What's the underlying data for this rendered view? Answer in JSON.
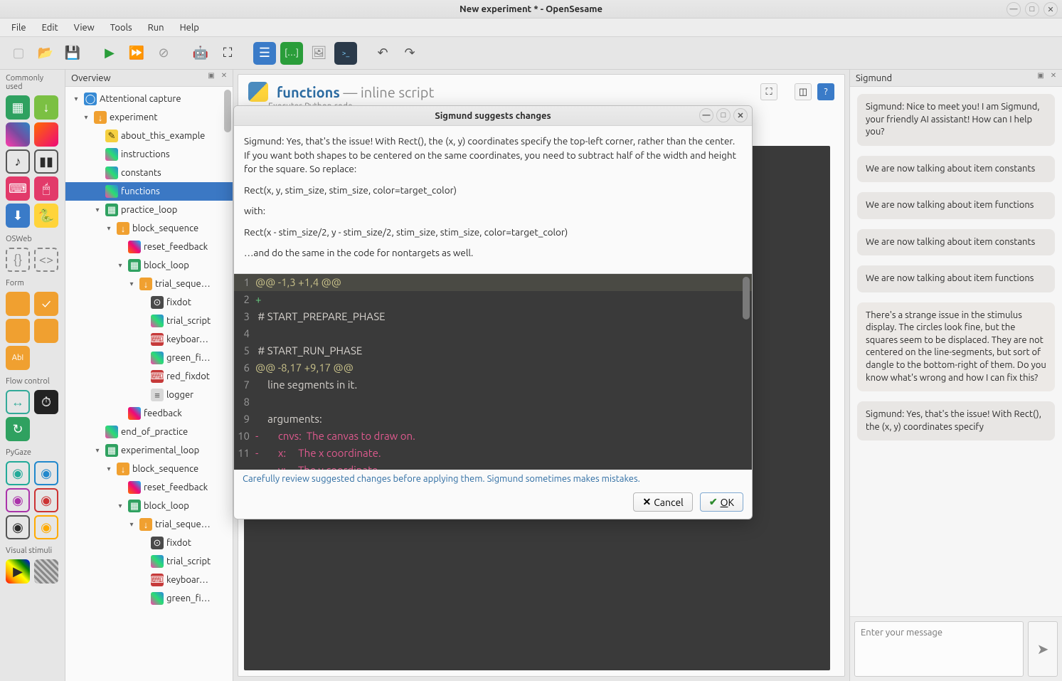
{
  "window": {
    "title": "New experiment * - OpenSesame"
  },
  "menus": [
    "File",
    "Edit",
    "View",
    "Tools",
    "Run",
    "Help"
  ],
  "palette": [
    {
      "label": "Commonly used"
    },
    {
      "label": "OSWeb"
    },
    {
      "label": "Form"
    },
    {
      "label": "Flow control"
    },
    {
      "label": "PyGaze"
    },
    {
      "label": "Visual stimuli"
    }
  ],
  "overview": {
    "title": "Overview",
    "items": [
      {
        "lvl": 0,
        "arrow": "▾",
        "icon": "exp",
        "label": "Attentional capture"
      },
      {
        "lvl": 1,
        "arrow": "▾",
        "icon": "seq",
        "label": "experiment"
      },
      {
        "lvl": 2,
        "arrow": "",
        "icon": "note",
        "label": "about_this_example"
      },
      {
        "lvl": 2,
        "arrow": "",
        "icon": "inline",
        "label": "instructions"
      },
      {
        "lvl": 2,
        "arrow": "",
        "icon": "inline",
        "label": "constants"
      },
      {
        "lvl": 2,
        "arrow": "",
        "icon": "inline",
        "label": "functions",
        "selected": true
      },
      {
        "lvl": 2,
        "arrow": "▾",
        "icon": "loop",
        "label": "practice_loop"
      },
      {
        "lvl": 3,
        "arrow": "▾",
        "icon": "seq",
        "label": "block_sequence"
      },
      {
        "lvl": 4,
        "arrow": "",
        "icon": "fb",
        "label": "reset_feedback"
      },
      {
        "lvl": 4,
        "arrow": "▾",
        "icon": "loop",
        "label": "block_loop"
      },
      {
        "lvl": 5,
        "arrow": "▾",
        "icon": "seq",
        "label": "trial_seque…"
      },
      {
        "lvl": 6,
        "arrow": "",
        "icon": "fix",
        "label": "fixdot"
      },
      {
        "lvl": 6,
        "arrow": "",
        "icon": "inline",
        "label": "trial_script"
      },
      {
        "lvl": 6,
        "arrow": "",
        "icon": "kb",
        "label": "keyboar…"
      },
      {
        "lvl": 6,
        "arrow": "",
        "icon": "inline",
        "label": "green_fi…"
      },
      {
        "lvl": 6,
        "arrow": "",
        "icon": "kb",
        "label": "red_fixdot"
      },
      {
        "lvl": 6,
        "arrow": "",
        "icon": "log",
        "label": "logger"
      },
      {
        "lvl": 4,
        "arrow": "",
        "icon": "fb",
        "label": "feedback"
      },
      {
        "lvl": 2,
        "arrow": "",
        "icon": "inline",
        "label": "end_of_practice"
      },
      {
        "lvl": 2,
        "arrow": "▾",
        "icon": "loop",
        "label": "experimental_loop"
      },
      {
        "lvl": 3,
        "arrow": "▾",
        "icon": "seq",
        "label": "block_sequence"
      },
      {
        "lvl": 4,
        "arrow": "",
        "icon": "fb",
        "label": "reset_feedback"
      },
      {
        "lvl": 4,
        "arrow": "▾",
        "icon": "loop",
        "label": "block_loop"
      },
      {
        "lvl": 5,
        "arrow": "▾",
        "icon": "seq",
        "label": "trial_seque…"
      },
      {
        "lvl": 6,
        "arrow": "",
        "icon": "fix",
        "label": "fixdot"
      },
      {
        "lvl": 6,
        "arrow": "",
        "icon": "inline",
        "label": "trial_script"
      },
      {
        "lvl": 6,
        "arrow": "",
        "icon": "kb",
        "label": "keyboar…"
      },
      {
        "lvl": 6,
        "arrow": "",
        "icon": "inline",
        "label": "green_fi…"
      }
    ]
  },
  "editor": {
    "item_name": "functions",
    "item_type": " — inline script",
    "subtitle": "Executes Python code"
  },
  "dialog": {
    "title": "Sigmund suggests changes",
    "explain1": "Sigmund: Yes, that's the issue! With Rect(), the (x, y) coordinates specify the top-left corner, rather than the center. If you want both shapes to be centered on the same coordinates, you need to subtract half of the width and height for the square. So replace:",
    "code1": "Rect(x, y, stim_size, stim_size, color=target_color)",
    "with": "with:",
    "code2": "Rect(x - stim_size/2, y - stim_size/2, stim_size, stim_size, color=target_color)",
    "explain2": "…and do the same in the code for nontargets as well.",
    "diff": [
      {
        "n": "1",
        "cls": "hunk hl",
        "t": "@@ -1,3 +1,4 @@"
      },
      {
        "n": "2",
        "cls": "add",
        "t": "+"
      },
      {
        "n": "3",
        "cls": "",
        "t": " # START_PREPARE_PHASE"
      },
      {
        "n": "4",
        "cls": "",
        "t": ""
      },
      {
        "n": "5",
        "cls": "",
        "t": " # START_RUN_PHASE"
      },
      {
        "n": "6",
        "cls": "hunk",
        "t": "@@ -8,17 +9,17 @@"
      },
      {
        "n": "7",
        "cls": "",
        "t": "     line segments in it."
      },
      {
        "n": "8",
        "cls": "",
        "t": ""
      },
      {
        "n": "9",
        "cls": "",
        "t": "     arguments:"
      },
      {
        "n": "10",
        "cls": "del",
        "t": "-        cnvs:  The canvas to draw on."
      },
      {
        "n": "11",
        "cls": "del",
        "t": "-        x:     The x coordinate."
      },
      {
        "n": "",
        "cls": "del",
        "t": "-        y:     The y coordinate."
      }
    ],
    "note": "Carefully review suggested changes before applying them. Sigmund sometimes makes mistakes.",
    "cancel": "Cancel",
    "ok": "OK"
  },
  "chat": {
    "title": "Sigmund",
    "messages": [
      "Sigmund: Nice to meet you! I am Sigmund, your friendly AI assistant! How can I help you?",
      "We are now talking about item constants",
      "We are now talking about item functions",
      "We are now talking about item constants",
      "We are now talking about item functions",
      "There's a strange issue in the stimulus display. The circles look fine, but the squares seem to be displaced. They are not centered on the line-segments, but sort of dangle to the bottom-right of them. Do you know what's wrong and how I can fix this?",
      "Sigmund: Yes, that's the issue! With Rect(), the (x, y) coordinates specify"
    ],
    "placeholder": "Enter your message"
  }
}
